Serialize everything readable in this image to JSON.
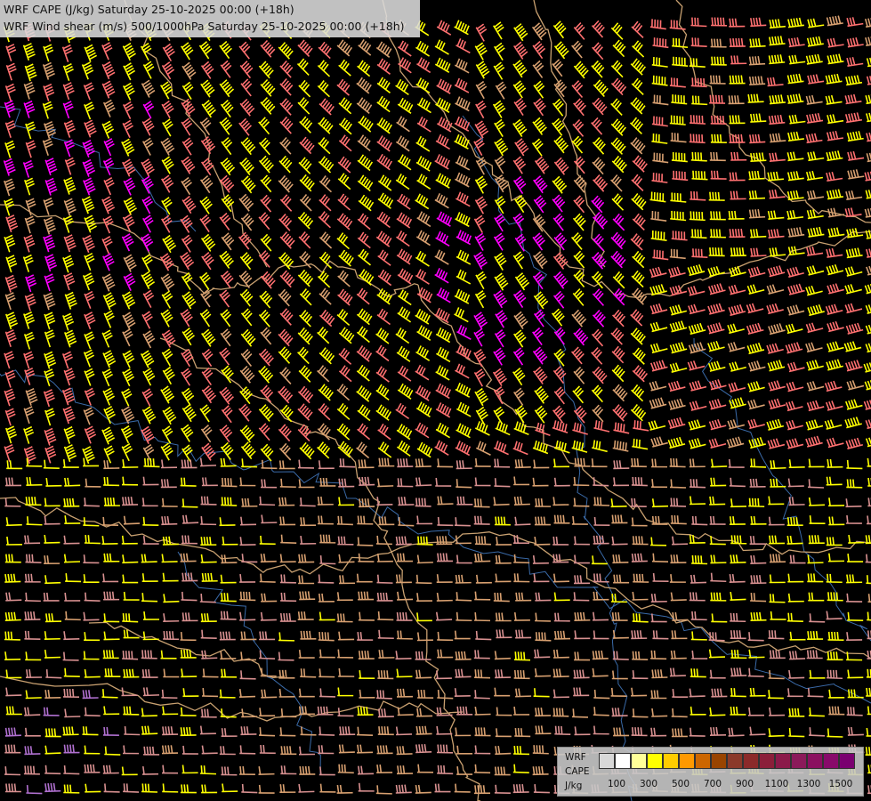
{
  "title": {
    "line1": "WRF CAPE (J/kg) Saturday 25-10-2025 00:00 (+18h)",
    "line2": "WRF Wind shear (m/s) 500/1000hPa Saturday 25-10-2025 00:00 (+18h)"
  },
  "legend": {
    "name_lines": [
      "WRF",
      "CAPE",
      "J/kg"
    ],
    "ticks": [
      "100",
      "300",
      "500",
      "700",
      "900",
      "1100",
      "1300",
      "1500"
    ],
    "colors": [
      "#d8d8d8",
      "#ffffff",
      "#ffff99",
      "#ffff00",
      "#ffcc00",
      "#ff9900",
      "#cc6600",
      "#994400",
      "#8b3a2a",
      "#8b2a2a",
      "#8b1f3a",
      "#8b1a4a",
      "#8b1a5a",
      "#8b1060",
      "#880a6a",
      "#7a0070"
    ]
  },
  "colors": {
    "background": "#000000",
    "border": "#c8a070",
    "river": "#3a6aa8",
    "barb_yellow": "#ffff00",
    "barb_salmon": "#ff7070",
    "barb_magenta": "#ff00ff",
    "barb_tan": "#d8a070",
    "barb_pink": "#d89090",
    "barb_violet": "#b070d0"
  }
}
